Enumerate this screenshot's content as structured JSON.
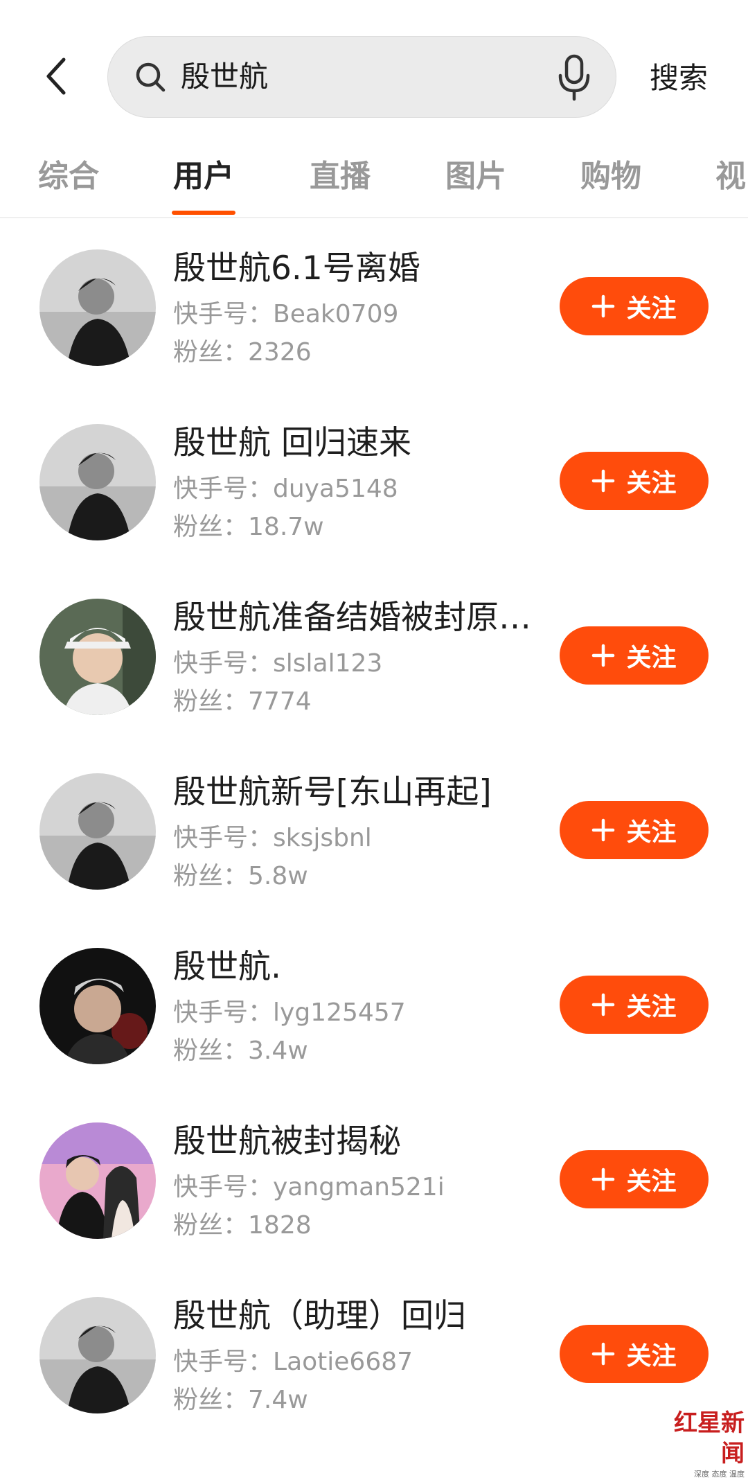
{
  "search": {
    "query": "殷世航",
    "button_label": "搜索"
  },
  "tabs": [
    {
      "label": "综合",
      "active": false
    },
    {
      "label": "用户",
      "active": true
    },
    {
      "label": "直播",
      "active": false
    },
    {
      "label": "图片",
      "active": false
    },
    {
      "label": "购物",
      "active": false
    },
    {
      "label": "视",
      "active": false
    }
  ],
  "users": [
    {
      "name": "殷世航6.1号离婚",
      "id_label": "快手号：",
      "id": "Beak0709",
      "fans_label": "粉丝：",
      "fans": "2326",
      "follow_label": "关注"
    },
    {
      "name": "殷世航 回归速来",
      "id_label": "快手号：",
      "id": "duya5148",
      "fans_label": "粉丝：",
      "fans": "18.7w",
      "follow_label": "关注"
    },
    {
      "name": "殷世航准备结婚被封原…",
      "id_label": "快手号：",
      "id": "slslal123",
      "fans_label": "粉丝：",
      "fans": "7774",
      "follow_label": "关注"
    },
    {
      "name": "殷世航新号[东山再起]",
      "id_label": "快手号：",
      "id": "sksjsbnl",
      "fans_label": "粉丝：",
      "fans": "5.8w",
      "follow_label": "关注"
    },
    {
      "name": "殷世航.",
      "id_label": "快手号：",
      "id": "lyg125457",
      "fans_label": "粉丝：",
      "fans": "3.4w",
      "follow_label": "关注"
    },
    {
      "name": "殷世航被封揭秘",
      "id_label": "快手号：",
      "id": "yangman521i",
      "fans_label": "粉丝：",
      "fans": "1828",
      "follow_label": "关注"
    },
    {
      "name": "殷世航（助理）回归",
      "id_label": "快手号：",
      "id": "Laotie6687",
      "fans_label": "粉丝：",
      "fans": "7.4w",
      "follow_label": "关注"
    }
  ],
  "watermark": {
    "title": "红星新闻",
    "subtitle": "深度 态度 温度"
  },
  "colors": {
    "accent": "#ff4c0c",
    "secondary_text": "#999999"
  }
}
